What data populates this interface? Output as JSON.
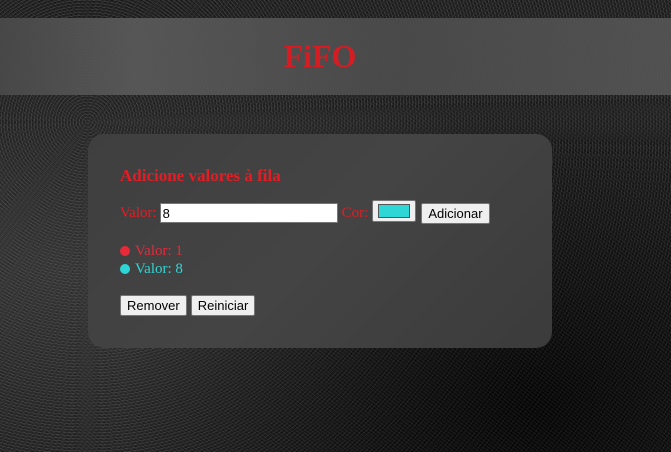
{
  "header": {
    "title": "FiFO"
  },
  "form": {
    "heading": "Adicione valores à fila",
    "value_label": "Valor:",
    "value_input": "8",
    "color_label": "Cor:",
    "color_value": "#2ed6d6",
    "add_button": "Adicionar"
  },
  "queue": {
    "items": [
      {
        "label": "Valor: 1",
        "color": "#e8293a"
      },
      {
        "label": "Valor: 8",
        "color": "#2ed6d6"
      }
    ]
  },
  "actions": {
    "remove_button": "Remover",
    "reset_button": "Reiniciar"
  },
  "colors": {
    "accent": "#e51c23"
  }
}
